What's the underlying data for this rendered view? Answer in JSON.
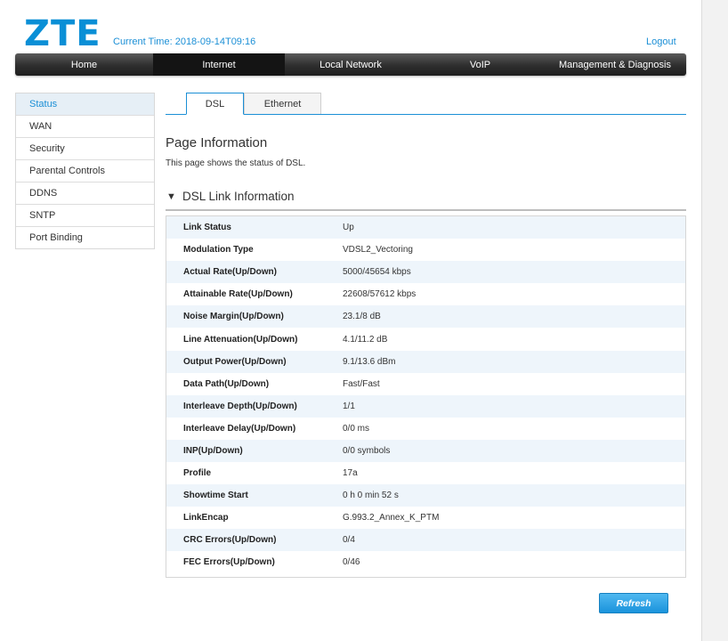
{
  "header": {
    "logo": "ZTE",
    "current_time_label": "Current Time:",
    "current_time_value": "2018-09-14T09:16",
    "logout": "Logout"
  },
  "nav": {
    "items": [
      {
        "label": "Home"
      },
      {
        "label": "Internet",
        "active": true
      },
      {
        "label": "Local Network"
      },
      {
        "label": "VoIP"
      },
      {
        "label": "Management & Diagnosis"
      }
    ]
  },
  "sidebar": {
    "items": [
      {
        "label": "Status",
        "active": true
      },
      {
        "label": "WAN"
      },
      {
        "label": "Security"
      },
      {
        "label": "Parental Controls"
      },
      {
        "label": "DDNS"
      },
      {
        "label": "SNTP"
      },
      {
        "label": "Port Binding"
      }
    ]
  },
  "tabs": [
    {
      "label": "DSL",
      "active": true
    },
    {
      "label": "Ethernet"
    }
  ],
  "page": {
    "title": "Page Information",
    "description": "This page shows the status of DSL."
  },
  "section": {
    "title": "DSL Link Information"
  },
  "dsl_table": {
    "rows": [
      {
        "key": "Link Status",
        "value": "Up"
      },
      {
        "key": "Modulation Type",
        "value": "VDSL2_Vectoring"
      },
      {
        "key": "Actual Rate(Up/Down)",
        "value": "5000/45654 kbps"
      },
      {
        "key": "Attainable Rate(Up/Down)",
        "value": "22608/57612 kbps"
      },
      {
        "key": "Noise Margin(Up/Down)",
        "value": "23.1/8 dB"
      },
      {
        "key": "Line Attenuation(Up/Down)",
        "value": "4.1/11.2 dB"
      },
      {
        "key": "Output Power(Up/Down)",
        "value": "9.1/13.6 dBm"
      },
      {
        "key": "Data Path(Up/Down)",
        "value": "Fast/Fast"
      },
      {
        "key": "Interleave Depth(Up/Down)",
        "value": "1/1"
      },
      {
        "key": "Interleave Delay(Up/Down)",
        "value": "0/0 ms"
      },
      {
        "key": "INP(Up/Down)",
        "value": "0/0 symbols"
      },
      {
        "key": "Profile",
        "value": "17a"
      },
      {
        "key": "Showtime Start",
        "value": "0 h 0 min 52 s"
      },
      {
        "key": "LinkEncap",
        "value": "G.993.2_Annex_K_PTM"
      },
      {
        "key": "CRC Errors(Up/Down)",
        "value": "0/4"
      },
      {
        "key": "FEC Errors(Up/Down)",
        "value": "0/46"
      }
    ]
  },
  "actions": {
    "refresh": "Refresh"
  },
  "colors": {
    "brand": "#0a8fd6",
    "accent": "#1b8fd6",
    "navbar": "#2e2e2e",
    "row_alt": "#eef5fb"
  }
}
